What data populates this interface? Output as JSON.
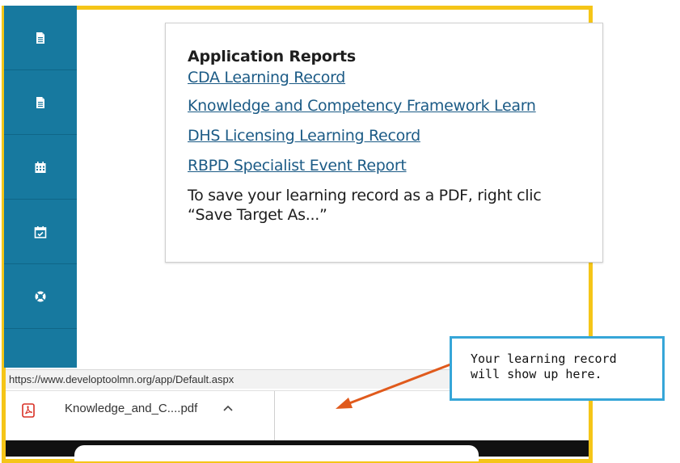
{
  "sidebar": {
    "items": [
      {
        "icon": "document-icon"
      },
      {
        "icon": "document-icon"
      },
      {
        "icon": "calendar-icon"
      },
      {
        "icon": "calendar-check-icon"
      },
      {
        "icon": "lifebuoy-icon"
      },
      {
        "icon": "partial-icon"
      }
    ],
    "color": "#17799f"
  },
  "reports": {
    "title": "Application Reports",
    "links": [
      "CDA Learning Record",
      "Knowledge and Competency Framework Learn",
      "DHS Licensing Learning Record",
      "RBPD Specialist Event Report"
    ],
    "note_line1": "To save your learning record as a PDF, right clic",
    "note_line2": "“Save Target As...”"
  },
  "status_bar": {
    "url": "https://www.developtoolmn.org/app/Default.aspx"
  },
  "download_shelf": {
    "filename": "Knowledge_and_C....pdf",
    "icon": "pdf-icon"
  },
  "callout": {
    "line1": "Your learning record",
    "line2": "will show up here.",
    "border_color": "#36a6d8",
    "arrow_color": "#e05a1c"
  },
  "frame_color": "#f5c518"
}
